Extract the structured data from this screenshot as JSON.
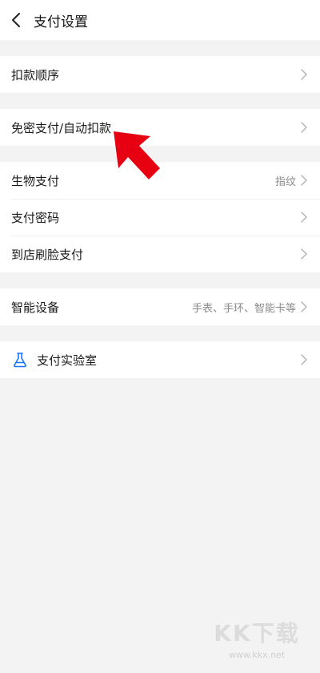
{
  "header": {
    "title": "支付设置"
  },
  "groups": [
    {
      "items": [
        {
          "label": "扣款顺序",
          "value": ""
        }
      ]
    },
    {
      "items": [
        {
          "label": "免密支付/自动扣款",
          "value": ""
        }
      ]
    },
    {
      "items": [
        {
          "label": "生物支付",
          "value": "指纹"
        },
        {
          "label": "支付密码",
          "value": ""
        },
        {
          "label": "到店刷脸支付",
          "value": ""
        }
      ]
    },
    {
      "items": [
        {
          "label": "智能设备",
          "value": "手表、手环、智能卡等"
        }
      ]
    },
    {
      "items": [
        {
          "label": "支付实验室",
          "value": "",
          "icon": "flask-icon"
        }
      ]
    }
  ],
  "watermark": {
    "logo": "KK下载",
    "url": "www.kkx.net"
  },
  "colors": {
    "background": "#f3f3f3",
    "card": "#ffffff",
    "arrow": "#e60012",
    "flask_icon": "#1677ff",
    "chevron": "#b5b5b5",
    "value_text": "#8a8a8a"
  },
  "icons": {
    "back": "chevron-left-icon",
    "row_chevron": "chevron-right-icon",
    "lab": "flask-icon",
    "annotation": "red-arrow-icon"
  }
}
